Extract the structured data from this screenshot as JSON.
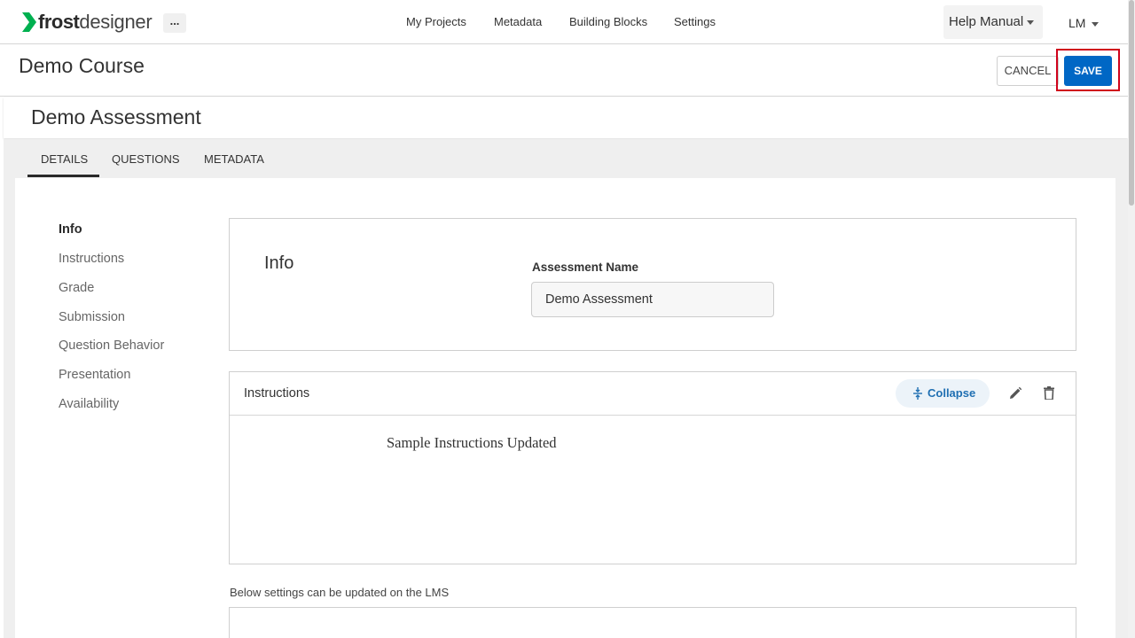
{
  "app": {
    "logo_bold": "frost",
    "logo_light": "designer",
    "more_label": "...",
    "brand_color": "#00b050"
  },
  "nav": {
    "items": [
      "My Projects",
      "Metadata",
      "Building Blocks",
      "Settings"
    ],
    "help_label": "Help Manual",
    "user_label": "LM"
  },
  "course": {
    "title": "Demo Course",
    "cancel_label": "CANCEL",
    "save_label": "SAVE",
    "save_color": "#0067c5",
    "highlight_color": "#d0021b"
  },
  "assessment": {
    "title": "Demo Assessment"
  },
  "tabs": {
    "items": [
      "DETAILS",
      "QUESTIONS",
      "METADATA"
    ],
    "active": "DETAILS"
  },
  "sidebar": {
    "items": [
      "Info",
      "Instructions",
      "Grade",
      "Submission",
      "Question Behavior",
      "Presentation",
      "Availability"
    ],
    "active": "Info"
  },
  "info": {
    "heading": "Info",
    "field_label": "Assessment Name",
    "field_value": "Demo Assessment"
  },
  "instructions": {
    "title": "Instructions",
    "collapse_label": "Collapse",
    "body": "Sample Instructions Updated"
  },
  "lms_note": "Below settings can be updated on the LMS"
}
